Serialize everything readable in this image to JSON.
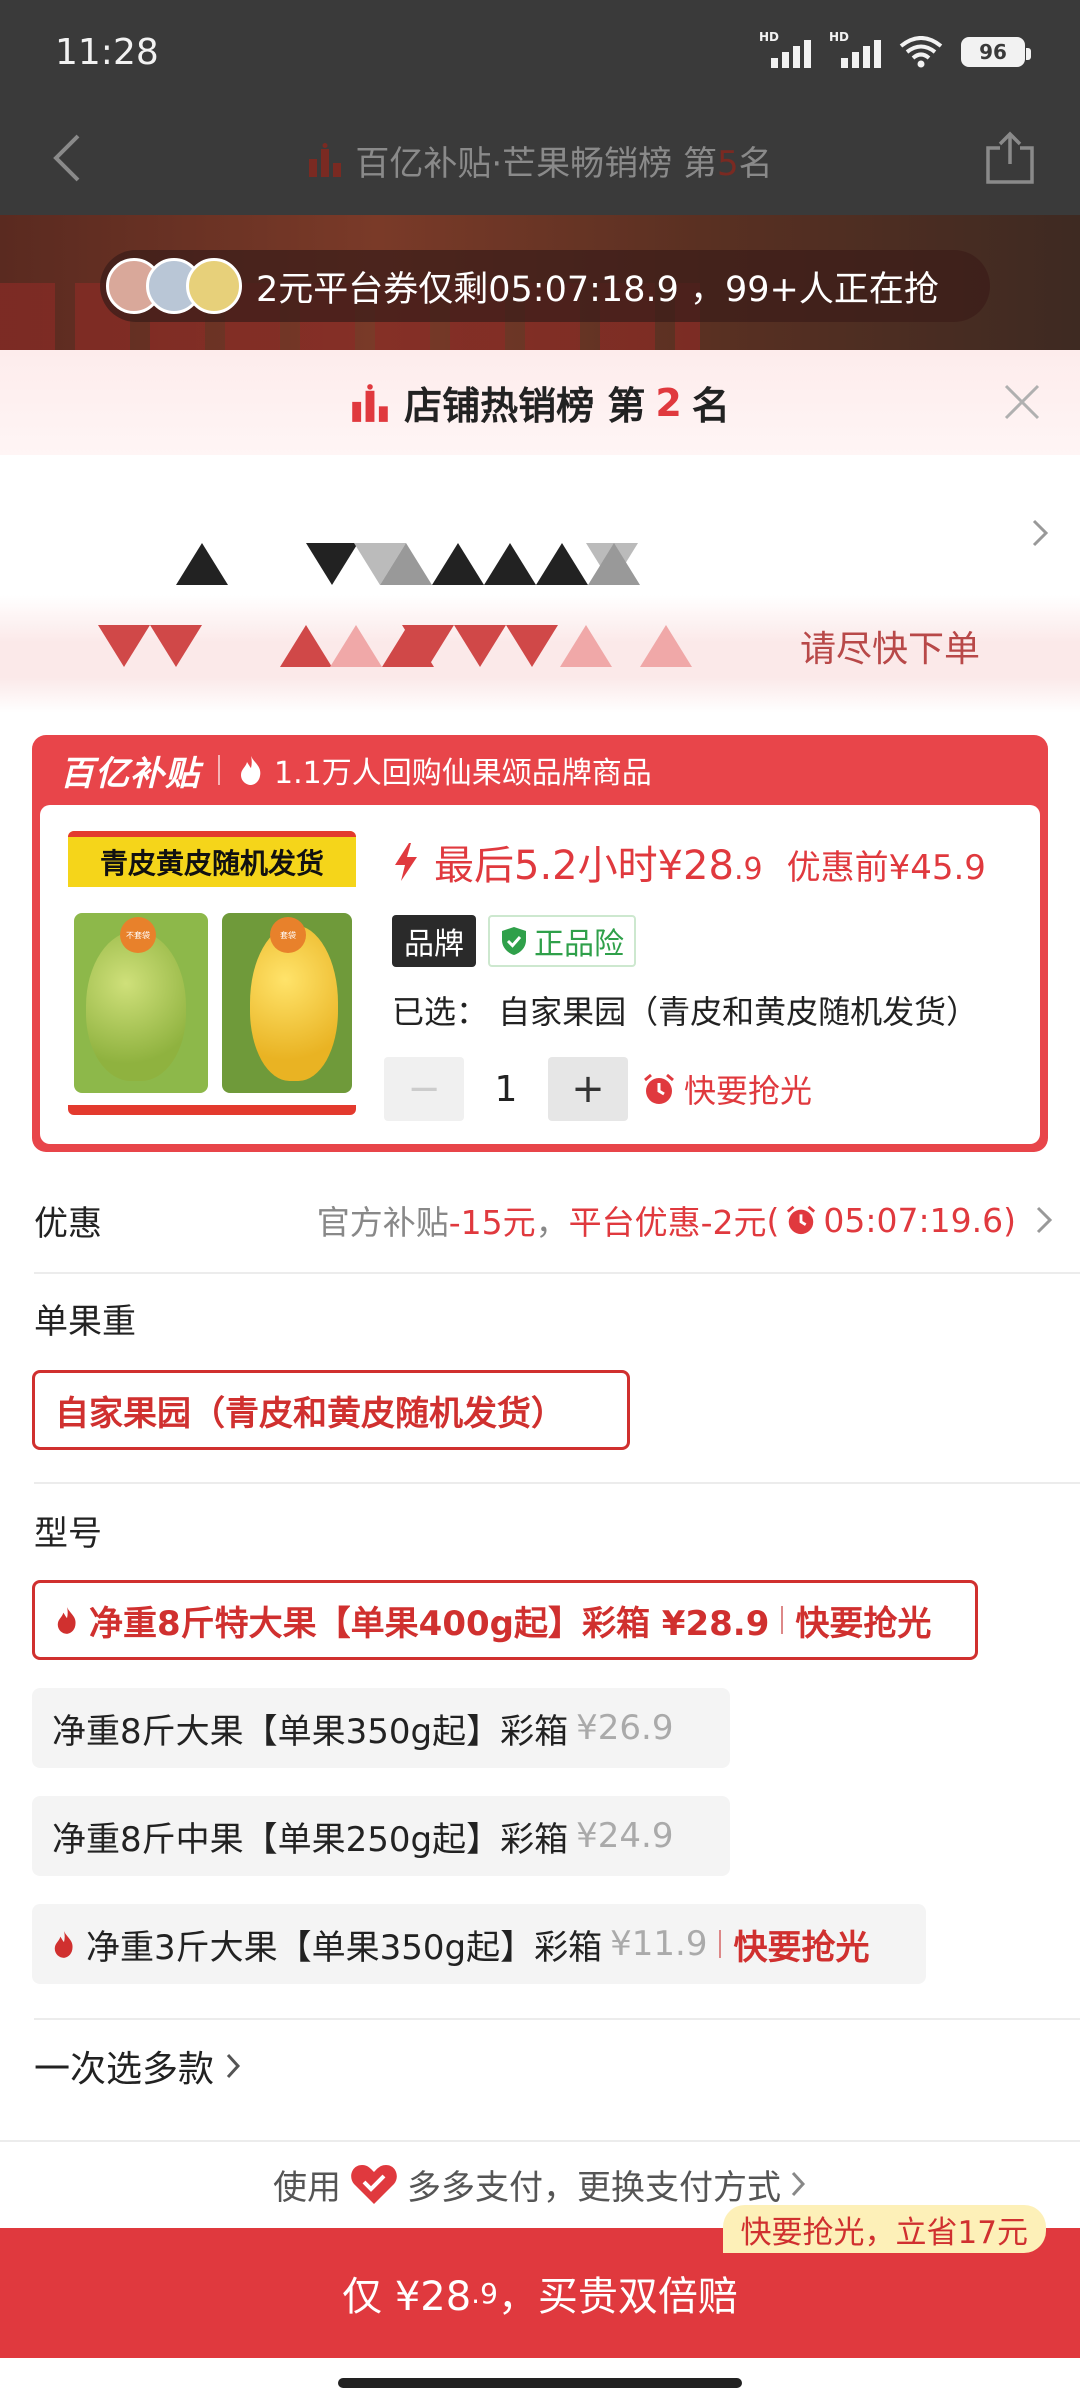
{
  "status": {
    "time": "11:28",
    "battery": "96"
  },
  "nav": {
    "title_prefix": "百亿补贴·芒果畅销榜 第",
    "rank": "5",
    "title_suffix": "名"
  },
  "banner": {
    "coupon_text": "2元平台券仅剩05:07:18.9 ，99+人正在抢"
  },
  "shop_rank": {
    "prefix": "店铺热销榜 第",
    "rank": "2",
    "suffix": "名"
  },
  "obscured": {
    "hurry_text": "请尽快下单"
  },
  "card": {
    "brand": "百亿补贴",
    "repurchase": "1.1万人回购仙果颂品牌商品",
    "thumb_title": "青皮黄皮随机发货",
    "thumb_tag_left": "不套袋",
    "thumb_tag_right": "套袋",
    "price_prefix": "最后5.2小时¥28",
    "price_decimal": ".9",
    "price_before": "优惠前¥45.9",
    "badge_brand": "品牌",
    "badge_genuine": "正品险",
    "selected": "已选： 自家果园（青皮和黄皮随机发货）",
    "qty_minus": "−",
    "qty": "1",
    "qty_plus": "+",
    "qty_hint": "快要抢光"
  },
  "discount": {
    "label": "优惠",
    "text1": "官方补贴",
    "amount1": "-15元",
    "comma": "，",
    "text2": "平台优惠-2元",
    "paren_open": " (",
    "timer": "05:07:19.6",
    "paren_close": ")"
  },
  "weight": {
    "label": "单果重",
    "option": "自家果园（青皮和黄皮随机发货）"
  },
  "model": {
    "label": "型号",
    "options": [
      {
        "text": "净重8斤特大果【单果400g起】彩箱 ¥28.9",
        "tag": "快要抢光"
      },
      {
        "text": "净重8斤大果【单果350g起】彩箱",
        "price": "¥26.9"
      },
      {
        "text": "净重8斤中果【单果250g起】彩箱",
        "price": "¥24.9"
      },
      {
        "text": "净重3斤大果【单果350g起】彩箱",
        "price": "¥11.9",
        "tag": "快要抢光"
      }
    ]
  },
  "multi": {
    "label": "一次选多款"
  },
  "pay": {
    "prefix": "使用",
    "text": "多多支付，更换支付方式"
  },
  "bottom": {
    "save_tag": "快要抢光，立省17元",
    "buy_main": "仅 ¥28",
    "buy_decimal": ".9",
    "buy_suffix": "，买贵双倍赔"
  },
  "colors": {
    "accent": "#e0393e",
    "brand_red": "#e8454a",
    "genuine_green": "#2fa04a"
  }
}
